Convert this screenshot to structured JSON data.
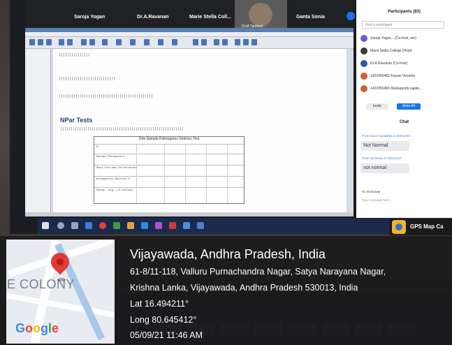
{
  "meet": {
    "participant_tiles": [
      "Saroja Yogan",
      "Dr.A.Ravanan",
      "Marie Stella Coll...",
      "Ganta Sonia"
    ],
    "cam_tile_label": "Dr.M.Tamilsel..."
  },
  "spss": {
    "section_title": "NPar Tests",
    "table_title": "One-Sample Kolmogorov-Smirnov Test",
    "row_labels": [
      "N",
      "Normal Parameters",
      "Most Extreme Differences",
      "Kolmogorov-Smirnov Z",
      "Asymp. Sig. (2-tailed)"
    ]
  },
  "panel": {
    "title": "Participants (83)",
    "search_placeholder": "Find a participant",
    "participants": [
      {
        "name": "Saroja Yogan... (Co-host, me)",
        "color": "#6f5bd6"
      },
      {
        "name": "Maris Stella College (Host)",
        "color": "#3a3a3a"
      },
      {
        "name": "Dr.A.Ravanan (Co-host)",
        "color": "#2c5aa0"
      },
      {
        "name": "1422050465 Kasani Vennela",
        "color": "#d85a2b"
      },
      {
        "name": "1422050466 Madugunda sajale...",
        "color": "#d85a2b"
      }
    ],
    "invite_label": "Invite",
    "mute_label": "Mute All",
    "chat_title": "Chat",
    "chat": [
      {
        "meta": "From ravuri sunaditya to Everyone:",
        "text": "Not Normal"
      },
      {
        "meta": "From sai sunny to Everyone:",
        "text": "not normal"
      }
    ],
    "chat_to": "To: Everyone",
    "chat_placeholder": "Type message here..."
  },
  "gps_app": {
    "label": "GPS Map Ca"
  },
  "map": {
    "area_label": "E COLONY",
    "brand": "Google"
  },
  "location": {
    "city": "Vijayawada, Andhra Pradesh, India",
    "address_line1": "61-8/11-118, Valluru Purnachandra Nagar, Satya Narayana Nagar,",
    "address_line2": "Krishna Lanka, Vijayawada, Andhra Pradesh 530013, India",
    "lat": "Lat 16.494211°",
    "long": "Long 80.645412°",
    "datetime": "05/09/21 11:46 AM"
  },
  "colors": {
    "accent": "#1a73e8",
    "pin": "#e53935",
    "taskbar": "#1b2a4a"
  }
}
